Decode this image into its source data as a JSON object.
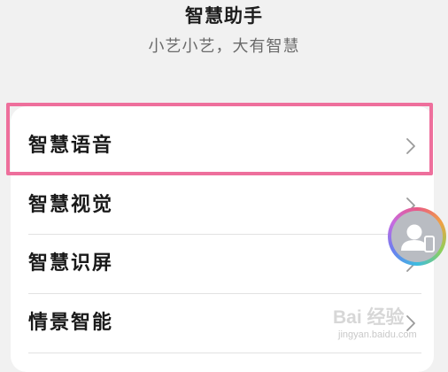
{
  "header": {
    "title": "智慧助手",
    "subtitle": "小艺小艺，大有智慧"
  },
  "menu": {
    "items": [
      {
        "label": "智慧语音",
        "highlighted": true
      },
      {
        "label": "智慧视觉"
      },
      {
        "label": "智慧识屏"
      },
      {
        "label": "情景智能"
      }
    ]
  },
  "floating_assistant": {
    "icon": "avatar-phone-icon"
  },
  "watermark": {
    "brand": "Bai 经验",
    "url": "jingyan.baidu.com"
  },
  "colors": {
    "background": "#f1f1f1",
    "card": "#ffffff",
    "highlight_border": "#ee6f9c",
    "text_primary": "#1a1a1a",
    "text_secondary": "#6a6a6a",
    "chevron": "#9a9a9a"
  }
}
